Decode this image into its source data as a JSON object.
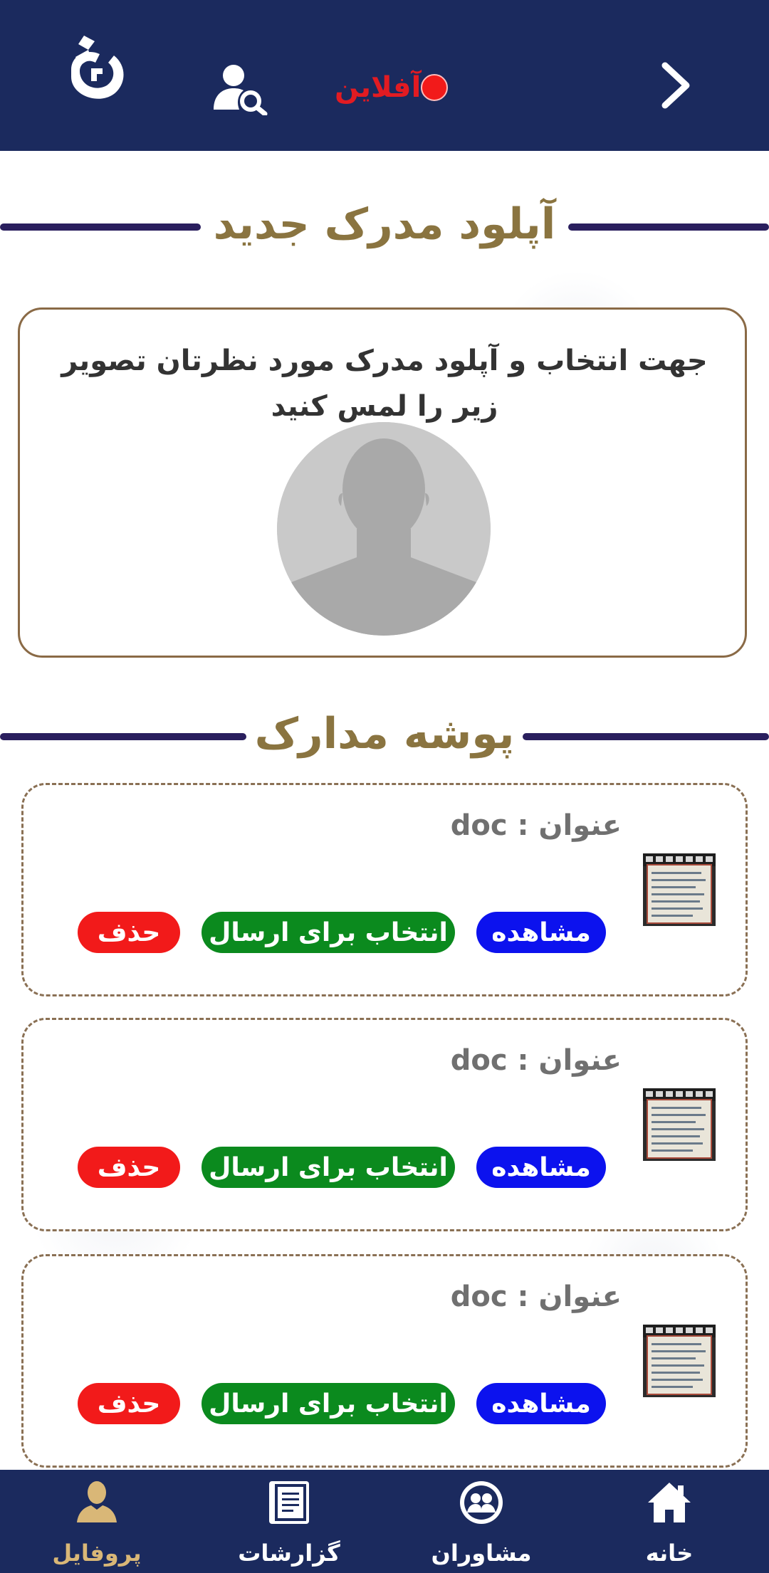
{
  "header": {
    "status_label": "آفلاین",
    "status_color": "#e21b22",
    "background": "#1b2a5e"
  },
  "upload_section": {
    "title": "آپلود مدرک جدید",
    "hint": "جهت انتخاب و آپلود مدرک مورد نظرتان تصویر زیر را لمس کنید"
  },
  "documents_section": {
    "title": "پوشه مدارک",
    "items": [
      {
        "title": "عنوان : doc",
        "view_label": "مشاهده",
        "select_label": "انتخاب برای ارسال",
        "delete_label": "حذف"
      },
      {
        "title": "عنوان : doc",
        "view_label": "مشاهده",
        "select_label": "انتخاب برای ارسال",
        "delete_label": "حذف"
      },
      {
        "title": "عنوان : doc",
        "view_label": "مشاهده",
        "select_label": "انتخاب برای ارسال",
        "delete_label": "حذف"
      }
    ]
  },
  "bottom_nav": {
    "items": [
      {
        "label": "پروفایل",
        "icon": "profile-icon",
        "active": true
      },
      {
        "label": "گزارشات",
        "icon": "reports-icon",
        "active": false
      },
      {
        "label": "مشاوران",
        "icon": "consultants-icon",
        "active": false
      },
      {
        "label": "خانه",
        "icon": "home-icon",
        "active": false
      }
    ]
  },
  "colors": {
    "navy": "#1b2a5e",
    "gold": "#8a7440",
    "view_blue": "#0c12ee",
    "select_green": "#0b8a1e",
    "delete_red": "#f21a1a",
    "active_nav": "#d9b777"
  }
}
